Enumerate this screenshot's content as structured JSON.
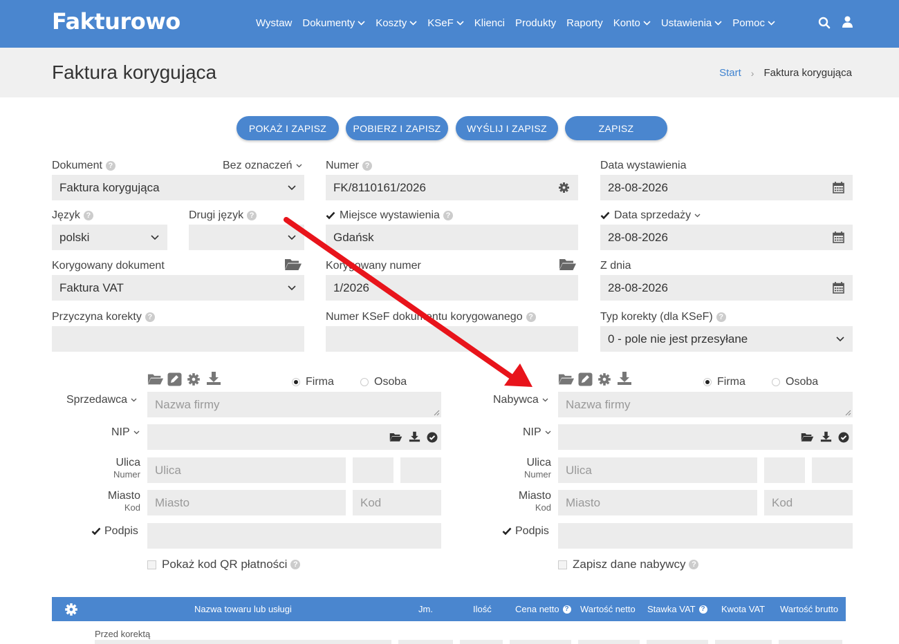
{
  "header": {
    "logo": "Fakturowo",
    "nav": [
      {
        "label": "Wystaw",
        "dropdown": false
      },
      {
        "label": "Dokumenty",
        "dropdown": true
      },
      {
        "label": "Koszty",
        "dropdown": true
      },
      {
        "label": "KSeF",
        "dropdown": true
      },
      {
        "label": "Klienci",
        "dropdown": false
      },
      {
        "label": "Produkty",
        "dropdown": false
      },
      {
        "label": "Raporty",
        "dropdown": false
      },
      {
        "label": "Konto",
        "dropdown": true
      },
      {
        "label": "Ustawienia",
        "dropdown": true
      },
      {
        "label": "Pomoc",
        "dropdown": true
      }
    ],
    "icons": [
      "search-icon",
      "user-icon"
    ]
  },
  "title": "Faktura korygująca",
  "breadcrumb": {
    "start": "Start",
    "current": "Faktura korygująca"
  },
  "buttons": {
    "show": "POKAŻ I ZAPISZ",
    "download": "POBIERZ I ZAPISZ",
    "send": "WYŚLIJ I ZAPISZ",
    "save": "ZAPISZ"
  },
  "form": {
    "dokument_label": "Dokument",
    "dokument_mark": "Bez oznaczeń",
    "dokument_value": "Faktura korygująca",
    "numer_label": "Numer",
    "numer_value": "FK/8110161/2026",
    "data_wyst_label": "Data wystawienia",
    "data_wyst_value": "28-08-2026",
    "jezyk_label": "Język",
    "jezyk_value": "polski",
    "drugi_jezyk_label": "Drugi język",
    "drugi_jezyk_value": "",
    "miejsce_label": "Miejsce wystawienia",
    "miejsce_value": "Gdańsk",
    "data_sprz_label": "Data sprzedaży",
    "data_sprz_value": "28-08-2026",
    "kor_dok_label": "Korygowany dokument",
    "kor_dok_value": "Faktura VAT",
    "kor_num_label": "Korygowany numer",
    "kor_num_value": "1/2026",
    "z_dnia_label": "Z dnia",
    "z_dnia_value": "28-08-2026",
    "przyczyna_label": "Przyczyna korekty",
    "przyczyna_value": "",
    "ksef_num_label": "Numer KSeF dokumentu korygowanego",
    "ksef_num_value": "",
    "typ_label": "Typ korekty (dla KSeF)",
    "typ_value": "0 - pole nie jest przesyłane"
  },
  "seller": {
    "label": "Sprzedawca",
    "firma": "Firma",
    "osoba": "Osoba",
    "name_placeholder": "Nazwa firmy",
    "nip": "NIP",
    "ulica": "Ulica",
    "numer": "Numer",
    "ulica_placeholder": "Ulica",
    "miasto": "Miasto",
    "kod": "Kod",
    "miasto_placeholder": "Miasto",
    "kod_placeholder": "Kod",
    "podpis": "Podpis",
    "extra_checkbox": "Pokaż kod QR płatności"
  },
  "buyer": {
    "label": "Nabywca",
    "firma": "Firma",
    "osoba": "Osoba",
    "name_placeholder": "Nazwa firmy",
    "nip": "NIP",
    "ulica": "Ulica",
    "numer": "Numer",
    "ulica_placeholder": "Ulica",
    "miasto": "Miasto",
    "kod": "Kod",
    "miasto_placeholder": "Miasto",
    "kod_placeholder": "Kod",
    "podpis": "Podpis",
    "extra_checkbox": "Zapisz dane nabywcy"
  },
  "table": {
    "columns": [
      "Nazwa towaru lub usługi",
      "Jm.",
      "Ilość",
      "Cena netto",
      "Wartość netto",
      "Stawka VAT",
      "Kwota VAT",
      "Wartość brutto"
    ],
    "section": "Przed korektą"
  },
  "colors": {
    "brand": "#4a86cf",
    "arrow": "#e8141b",
    "field": "#ececec"
  }
}
